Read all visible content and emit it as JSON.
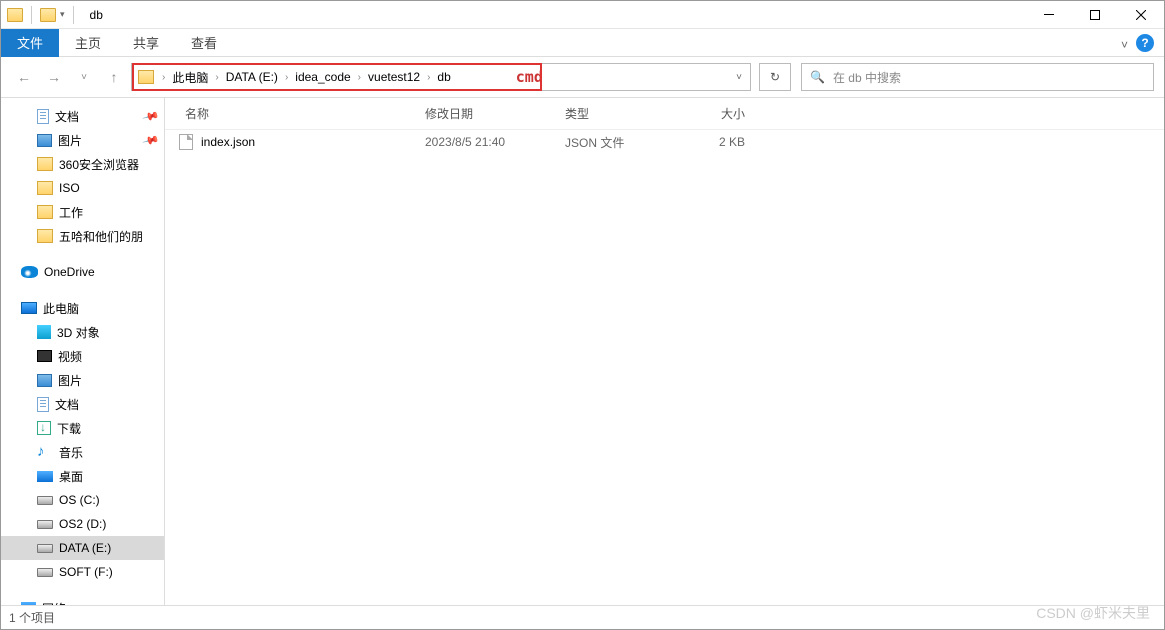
{
  "titlebar": {
    "title": "db"
  },
  "ribbon": {
    "file": "文件",
    "tabs": [
      "主页",
      "共享",
      "查看"
    ]
  },
  "address": {
    "crumbs": [
      "此电脑",
      "DATA (E:)",
      "idea_code",
      "vuetest12",
      "db"
    ],
    "cmd": "cmd",
    "search_placeholder": "在 db 中搜索"
  },
  "sidebar": {
    "quick": [
      {
        "label": "文档",
        "icon": "doc",
        "pinned": true
      },
      {
        "label": "图片",
        "icon": "pic",
        "pinned": true
      },
      {
        "label": "360安全浏览器",
        "icon": "folder"
      },
      {
        "label": "ISO",
        "icon": "folder"
      },
      {
        "label": "工作",
        "icon": "folder"
      },
      {
        "label": "五哈和他们的朋",
        "icon": "folder"
      }
    ],
    "onedrive": "OneDrive",
    "thispc": "此电脑",
    "pc_items": [
      {
        "label": "3D 对象",
        "icon": "3d"
      },
      {
        "label": "视频",
        "icon": "vid"
      },
      {
        "label": "图片",
        "icon": "pic"
      },
      {
        "label": "文档",
        "icon": "doc"
      },
      {
        "label": "下载",
        "icon": "dl"
      },
      {
        "label": "音乐",
        "icon": "music"
      },
      {
        "label": "桌面",
        "icon": "desk"
      },
      {
        "label": "OS (C:)",
        "icon": "drive"
      },
      {
        "label": "OS2 (D:)",
        "icon": "drive"
      },
      {
        "label": "DATA (E:)",
        "icon": "drive",
        "selected": true
      },
      {
        "label": "SOFT (F:)",
        "icon": "drive"
      }
    ],
    "network": "网络"
  },
  "columns": {
    "name": "名称",
    "date": "修改日期",
    "type": "类型",
    "size": "大小"
  },
  "files": [
    {
      "name": "index.json",
      "date": "2023/8/5 21:40",
      "type": "JSON 文件",
      "size": "2 KB"
    }
  ],
  "status": {
    "text": "1 个项目"
  },
  "watermark": "CSDN @虾米夫里"
}
